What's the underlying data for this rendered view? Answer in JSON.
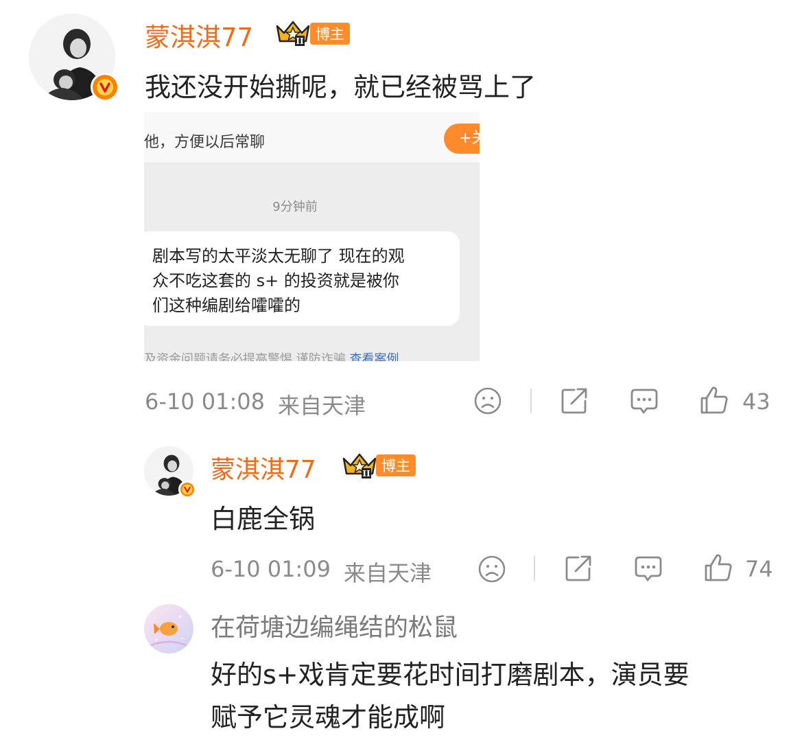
{
  "comments": [
    {
      "user": "蒙淇淇77",
      "badge": "博主",
      "crown_level": "II",
      "text": "我还没开始撕呢，就已经被骂上了",
      "attachment": {
        "top_text": "他，方便以后常聊",
        "follow_label": "+关",
        "time": "9分钟前",
        "bubble_lines": [
          "剧本写的太平淡太无聊了 现在的观",
          "众不吃这套的 s+ 的投资就是被你",
          "们这种编剧给嚯嚯的"
        ],
        "bottom_text": "及资金问题请务必提高警惕    谨防诈骗  ",
        "bottom_link": "查看案例"
      },
      "time": "6-10 01:08",
      "location": "来自天津",
      "likes": "43"
    },
    {
      "user": "蒙淇淇77",
      "badge": "博主",
      "crown_level": "II",
      "text": "白鹿全锅",
      "time": "6-10 01:09",
      "location": "来自天津",
      "likes": "74"
    },
    {
      "user": "在荷塘边编绳结的松鼠",
      "text_lines": [
        "好的s+戏肯定要花时间打磨剧本，演员要",
        "赋予它灵魂才能成啊"
      ]
    }
  ],
  "colors": {
    "username": "#ef6b1c",
    "badge_bg": "#ff8c2a",
    "verified": "#ff8200",
    "meta": "#8a8a8a",
    "link": "#3c6ec6"
  },
  "icons": [
    "sad-face-icon",
    "share-icon",
    "comment-icon",
    "thumbs-up-icon",
    "crown-icon",
    "verified-v-icon"
  ]
}
